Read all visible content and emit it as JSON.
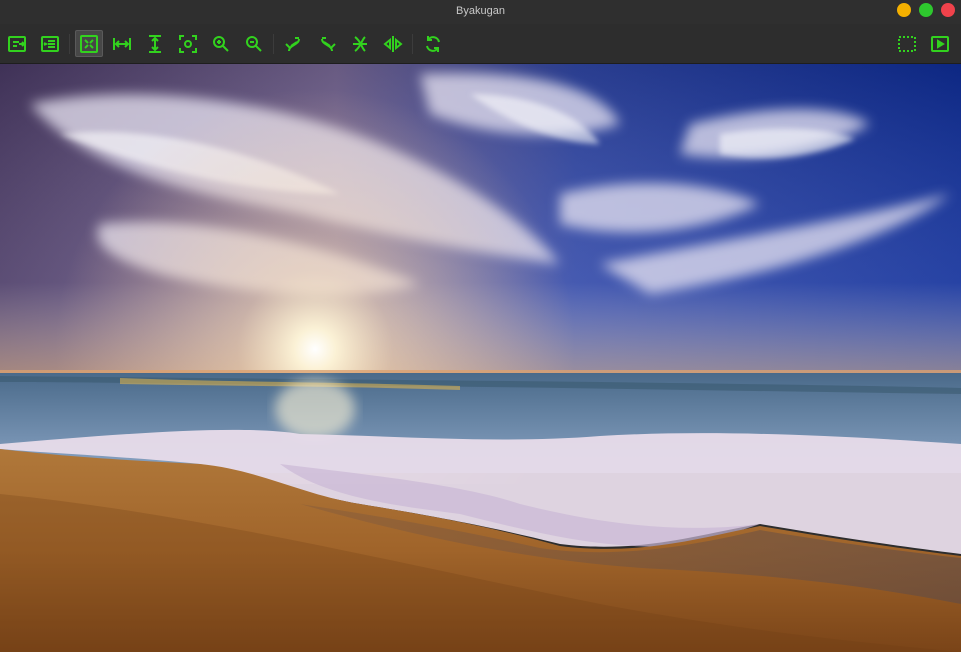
{
  "window": {
    "title": "Byakugan"
  },
  "colors": {
    "accent": "#32d21e",
    "toolbar_bg": "#2d2d2d",
    "titlebar_bg": "#2f2f2f"
  },
  "toolbar": {
    "left_buttons": [
      "open-file-icon",
      "open-folder-icon",
      "fit-to-window-icon",
      "fit-width-icon",
      "fit-height-icon",
      "original-size-icon",
      "zoom-in-icon",
      "zoom-out-icon",
      "rotate-left-icon",
      "rotate-right-icon",
      "flip-vertical-icon",
      "flip-horizontal-icon",
      "refresh-icon"
    ],
    "right_buttons": [
      "fullscreen-icon",
      "slideshow-icon"
    ],
    "active": "fit-to-window-icon"
  },
  "image": {
    "subject": "beach-sunset-photo"
  }
}
